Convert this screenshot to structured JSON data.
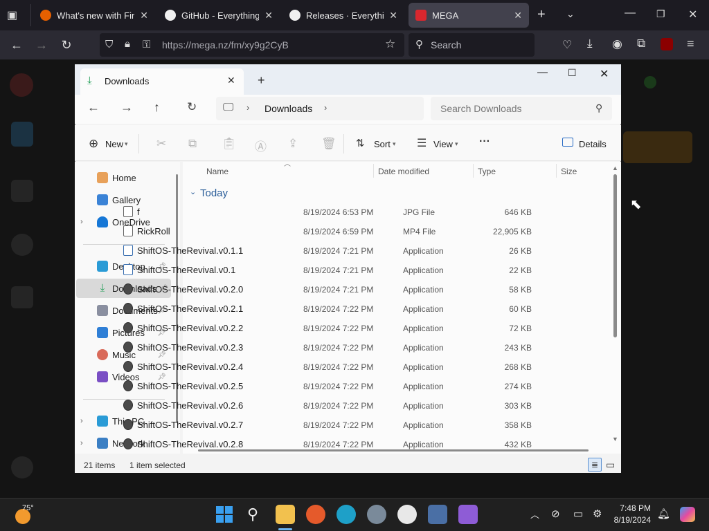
{
  "browser": {
    "tabs": [
      {
        "title": "What's new with Firefo",
        "favicon_color": "#e66000"
      },
      {
        "title": "GitHub - EverythingWi",
        "favicon_color": "#f0f0f0"
      },
      {
        "title": "Releases · EverythingW",
        "favicon_color": "#f0f0f0"
      },
      {
        "title": "MEGA",
        "favicon_color": "#d9272e"
      }
    ],
    "url": "https://mega.nz/fm/xy9g2CyB",
    "search_placeholder": "Search"
  },
  "explorer": {
    "tab_title": "Downloads",
    "breadcrumb": "Downloads",
    "search_placeholder": "Search Downloads",
    "commands": {
      "new": "New",
      "sort": "Sort",
      "view": "View",
      "more": "···",
      "details": "Details"
    },
    "nav": {
      "quick": [
        "Home",
        "Gallery",
        "OneDrive"
      ],
      "pinned": [
        "Desktop",
        "Downloads",
        "Documents",
        "Pictures",
        "Music",
        "Videos"
      ],
      "bottom": [
        "This PC",
        "Network"
      ]
    },
    "columns": {
      "name": "Name",
      "date": "Date modified",
      "type": "Type",
      "size": "Size"
    },
    "group": "Today",
    "files": [
      {
        "name": "f",
        "date": "8/19/2024 6:53 PM",
        "type": "JPG File",
        "size": "646 KB",
        "kind": "doc"
      },
      {
        "name": "RickRoll",
        "date": "8/19/2024 6:59 PM",
        "type": "MP4 File",
        "size": "22,905 KB",
        "kind": "doc"
      },
      {
        "name": "ShiftOS-TheRevival.v0.1.1",
        "date": "8/19/2024 7:21 PM",
        "type": "Application",
        "size": "26 KB",
        "kind": "exe"
      },
      {
        "name": "ShiftOS-TheRevival.v0.1",
        "date": "8/19/2024 7:21 PM",
        "type": "Application",
        "size": "22 KB",
        "kind": "exe"
      },
      {
        "name": "ShiftOS-TheRevival.v0.2.0",
        "date": "8/19/2024 7:21 PM",
        "type": "Application",
        "size": "58 KB",
        "kind": "app"
      },
      {
        "name": "ShiftOS-TheRevival.v0.2.1",
        "date": "8/19/2024 7:22 PM",
        "type": "Application",
        "size": "60 KB",
        "kind": "app"
      },
      {
        "name": "ShiftOS-TheRevival.v0.2.2",
        "date": "8/19/2024 7:22 PM",
        "type": "Application",
        "size": "72 KB",
        "kind": "app"
      },
      {
        "name": "ShiftOS-TheRevival.v0.2.3",
        "date": "8/19/2024 7:22 PM",
        "type": "Application",
        "size": "243 KB",
        "kind": "app"
      },
      {
        "name": "ShiftOS-TheRevival.v0.2.4",
        "date": "8/19/2024 7:22 PM",
        "type": "Application",
        "size": "268 KB",
        "kind": "app"
      },
      {
        "name": "ShiftOS-TheRevival.v0.2.5",
        "date": "8/19/2024 7:22 PM",
        "type": "Application",
        "size": "274 KB",
        "kind": "app"
      },
      {
        "name": "ShiftOS-TheRevival.v0.2.6",
        "date": "8/19/2024 7:22 PM",
        "type": "Application",
        "size": "303 KB",
        "kind": "app"
      },
      {
        "name": "ShiftOS-TheRevival.v0.2.7",
        "date": "8/19/2024 7:22 PM",
        "type": "Application",
        "size": "358 KB",
        "kind": "app"
      },
      {
        "name": "ShiftOS-TheRevival.v0.2.8",
        "date": "8/19/2024 7:22 PM",
        "type": "Application",
        "size": "432 KB",
        "kind": "app"
      }
    ],
    "status": {
      "items": "21 items",
      "selected": "1 item selected"
    }
  },
  "taskbar": {
    "weather": "75°",
    "time": "7:48 PM",
    "date": "8/19/2024"
  }
}
